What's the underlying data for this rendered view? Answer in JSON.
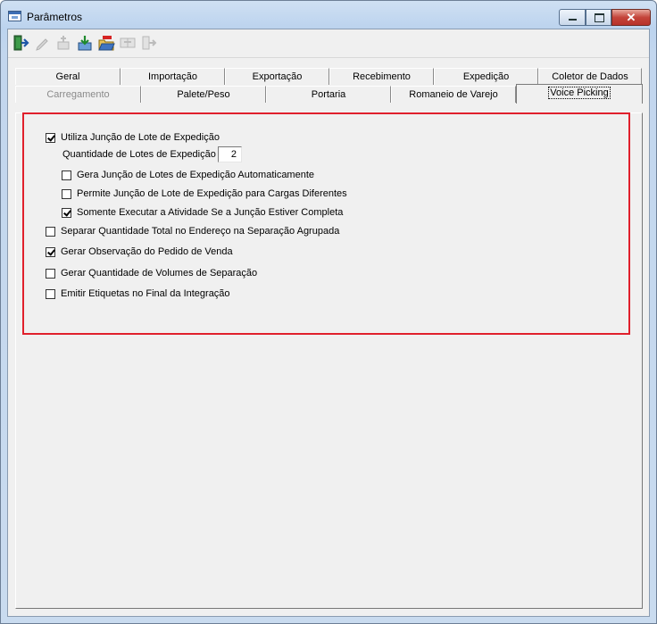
{
  "window": {
    "title": "Parâmetros",
    "minimize_glyph": "",
    "maximize_glyph": "",
    "close_glyph": "✕"
  },
  "toolbar": {
    "buttons": [
      {
        "icon": "exit-door-icon",
        "enabled": true
      },
      {
        "icon": "edit-pencil-icon",
        "enabled": false
      },
      {
        "icon": "add-record-icon",
        "enabled": false
      },
      {
        "icon": "save-download-icon",
        "enabled": true
      },
      {
        "icon": "open-folder-icon",
        "enabled": true
      },
      {
        "icon": "copy-record-icon",
        "enabled": false
      },
      {
        "icon": "export-arrow-icon",
        "enabled": false
      }
    ]
  },
  "tabs": {
    "row1": [
      "Geral",
      "Importação",
      "Exportação",
      "Recebimento",
      "Expedição",
      "Coletor de Dados"
    ],
    "row2": [
      "Carregamento",
      "Palete/Peso",
      "Portaria",
      "Romaneio de Varejo",
      "Voice Picking"
    ],
    "active": "Voice Picking",
    "disabled": [
      "Carregamento"
    ]
  },
  "options": {
    "utiliza_juncao": {
      "label": "Utiliza Junção de Lote de Expedição",
      "checked": true
    },
    "quantidade_lotes": {
      "label": "Quantidade de Lotes de Expedição",
      "value": "2"
    },
    "gera_juncao_auto": {
      "label": "Gera Junção de Lotes de Expedição Automaticamente",
      "checked": false
    },
    "permite_juncao_cargas": {
      "label": "Permite Junção de Lote de Expedição para Cargas Diferentes",
      "checked": false
    },
    "somente_executar": {
      "label": "Somente Executar a Atividade Se a Junção Estiver Completa",
      "checked": true
    },
    "separar_quantidade": {
      "label": "Separar Quantidade Total no Endereço na Separação Agrupada",
      "checked": false
    },
    "gerar_observacao": {
      "label": "Gerar Observação do Pedido de Venda",
      "checked": true
    },
    "gerar_volumes": {
      "label": "Gerar Quantidade de Volumes de Separação",
      "checked": false
    },
    "emitir_etiquetas": {
      "label": "Emitir Etiquetas no Final da Integração",
      "checked": false
    }
  },
  "colors": {
    "highlight_border": "#e0202c",
    "client_bg": "#f0f0f0"
  }
}
